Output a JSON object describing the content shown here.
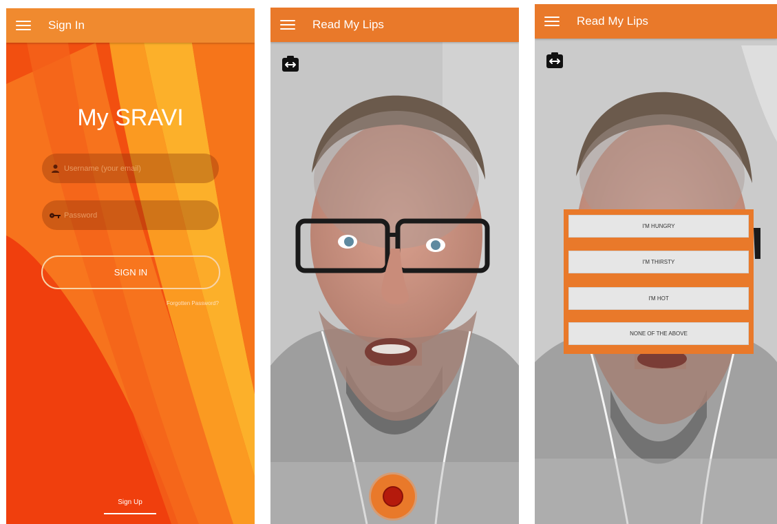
{
  "screens": {
    "signin": {
      "title": "Sign In",
      "brand": "My SRAVI",
      "username_placeholder": "Username (your email)",
      "password_placeholder": "Password",
      "signin_label": "SIGN IN",
      "forgot_label": "Forgotten Password?",
      "signup_label": "Sign Up"
    },
    "record": {
      "title": "Read My Lips"
    },
    "results": {
      "title": "Read My Lips",
      "options": [
        "I'M HUNGRY",
        "I'M THIRSTY",
        "I'M HOT",
        "NONE OF THE ABOVE"
      ]
    }
  },
  "icons": {
    "menu": "menu-icon",
    "user": "user-icon",
    "key": "key-icon",
    "camera_switch": "camera-switch-icon",
    "record": "record-icon"
  },
  "colors": {
    "appbar": "#e9792a",
    "signin_background": "#f15a0e",
    "record_button": "#e9792a",
    "record_dot": "#b41a0c"
  }
}
